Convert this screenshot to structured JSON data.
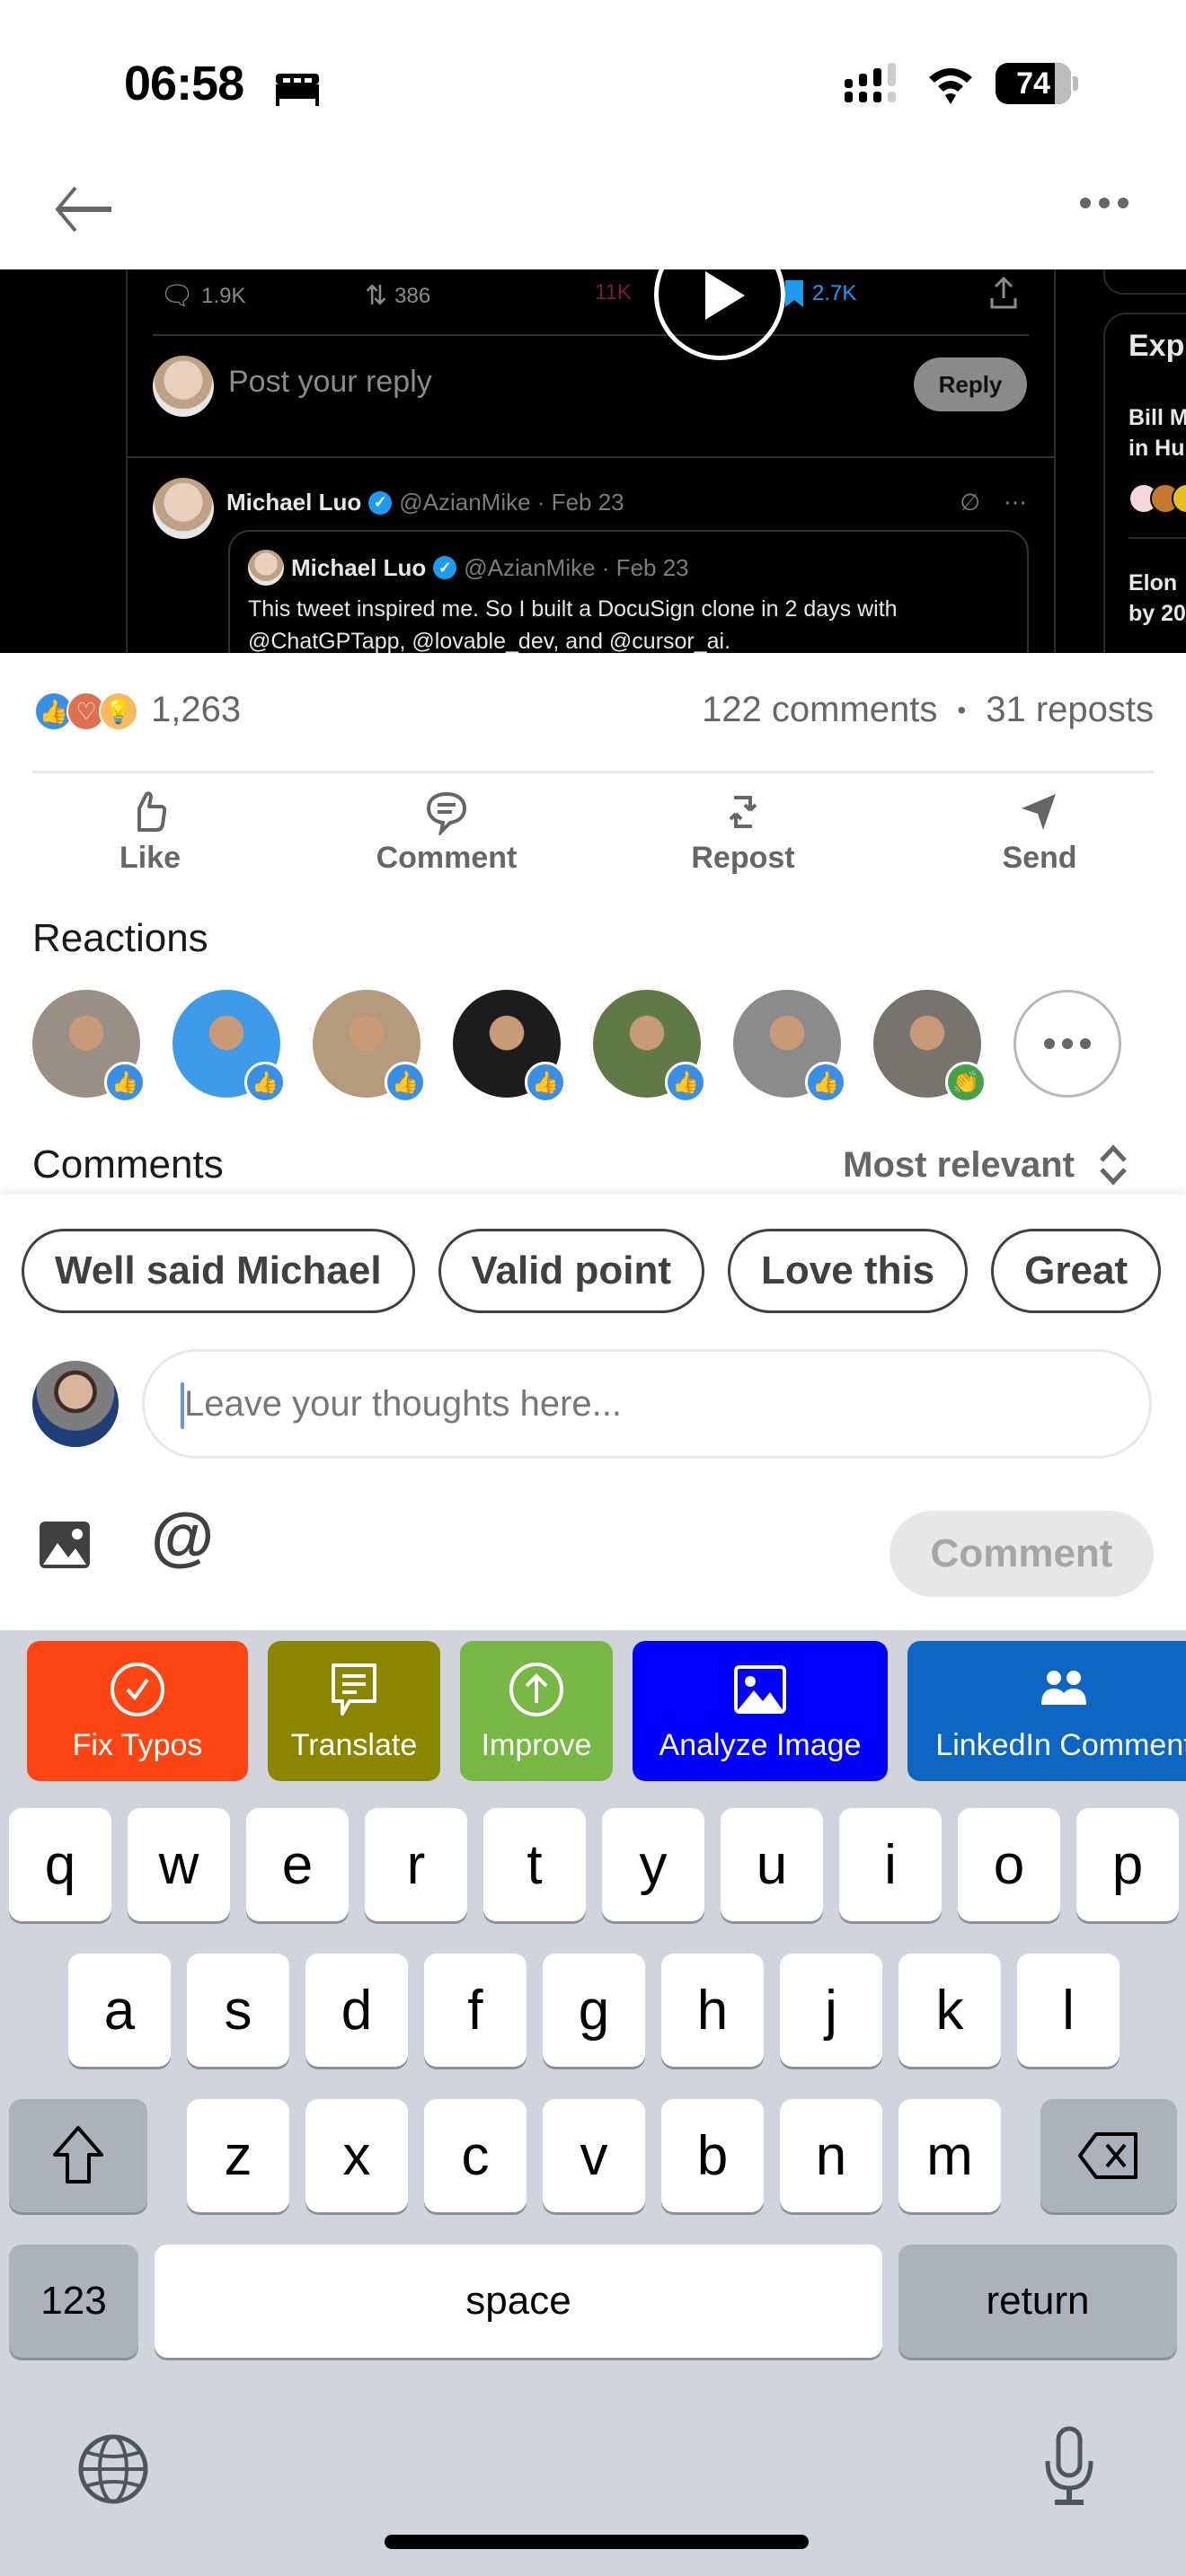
{
  "status_bar": {
    "time": "06:58",
    "focus_icon": "bed-icon",
    "battery": "74"
  },
  "nav": {
    "back_icon": "back-arrow-icon",
    "more_icon": "more-horizontal-icon"
  },
  "media": {
    "tweet_stats": {
      "replies": "1.9K",
      "reposts": "386",
      "likes": "11K",
      "bookmarks": "2.7K"
    },
    "reply_placeholder": "Post your reply",
    "reply_button": "Reply",
    "author_name": "Michael Luo",
    "author_meta": "@AzianMike · Feb 23",
    "quote_author_name": "Michael Luo",
    "quote_author_meta": "@AzianMike · Feb 23",
    "quote_text": "This tweet inspired me. So I built a DocuSign clone in 2 days with @ChatGPTapp, @lovable_dev, and @cursor_ai.",
    "trends_title": "Exp",
    "trend_1": [
      "Bill M",
      "in Hu"
    ],
    "trend_2": [
      "Elon",
      "by 20"
    ]
  },
  "social": {
    "reaction_types": [
      "like",
      "love",
      "insightful"
    ],
    "reaction_count": "1,263",
    "comments": "122 comments",
    "separator": "•",
    "reposts": "31 reposts"
  },
  "actions": [
    {
      "label": "Like",
      "icon": "thumbs-up-icon"
    },
    {
      "label": "Comment",
      "icon": "comment-icon"
    },
    {
      "label": "Repost",
      "icon": "repost-icon"
    },
    {
      "label": "Send",
      "icon": "send-icon"
    }
  ],
  "reactions": {
    "title": "Reactions",
    "people": [
      {
        "reaction": "like",
        "bg": "#9a8f84"
      },
      {
        "reaction": "like",
        "bg": "#3d9be9"
      },
      {
        "reaction": "like",
        "bg": "#b59b7c"
      },
      {
        "reaction": "like",
        "bg": "#1c1c1c"
      },
      {
        "reaction": "like",
        "bg": "#5f7a46"
      },
      {
        "reaction": "like",
        "bg": "#8b8b8b"
      },
      {
        "reaction": "celebrate",
        "bg": "#77746f"
      }
    ],
    "more_icon": "more-horizontal-icon"
  },
  "comments": {
    "title": "Comments",
    "sort_label": "Most relevant",
    "sort_icon": "chevron-up-down-icon"
  },
  "composer": {
    "suggestions": [
      "Well said Michael",
      "Valid point",
      "Love this",
      "Great"
    ],
    "input_placeholder": "Leave your thoughts here...",
    "input_value": "",
    "image_icon": "image-icon",
    "mention_label": "@",
    "submit_label": "Comment"
  },
  "keyboard": {
    "ai_actions": [
      {
        "label": "Fix Typos",
        "color": "#fd4514",
        "icon": "check-circle-icon"
      },
      {
        "label": "Translate",
        "color": "#8b8600",
        "icon": "speech-bubble-icon"
      },
      {
        "label": "Improve",
        "color": "#76b843",
        "icon": "arrow-up-circle-icon"
      },
      {
        "label": "Analyze Image",
        "color": "#0000fe",
        "icon": "image-icon"
      },
      {
        "label": "LinkedIn Comment",
        "color": "#0d67c2",
        "icon": "people-icon"
      }
    ],
    "row1": [
      "q",
      "w",
      "e",
      "r",
      "t",
      "y",
      "u",
      "i",
      "o",
      "p"
    ],
    "row2": [
      "a",
      "s",
      "d",
      "f",
      "g",
      "h",
      "j",
      "k",
      "l"
    ],
    "row3": [
      "z",
      "x",
      "c",
      "v",
      "b",
      "n",
      "m"
    ],
    "numbers_label": "123",
    "space_label": "space",
    "return_label": "return",
    "shift_icon": "shift-icon",
    "delete_icon": "delete-icon",
    "globe_icon": "globe-icon",
    "mic_icon": "microphone-icon"
  }
}
